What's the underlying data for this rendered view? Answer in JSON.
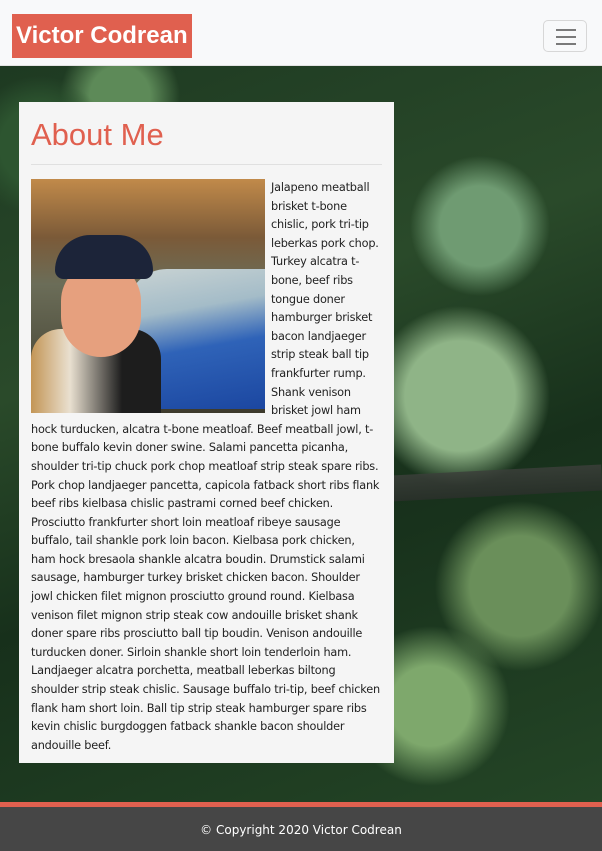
{
  "navbar": {
    "brand": "Victor Codrean",
    "toggler_icon": "hamburger-menu-icon"
  },
  "hero": {
    "background_desc": "aerial forest photo"
  },
  "about": {
    "title": "About Me",
    "photo_desc": "portrait photo",
    "text": "Jalapeno meatball brisket t-bone chislic, pork tri-tip leberkas pork chop. Turkey alcatra t-bone, beef ribs tongue doner hamburger brisket bacon landjaeger strip steak ball tip frankfurter rump. Shank venison brisket jowl ham hock turducken, alcatra t-bone meatloaf. Beef meatball jowl, t-bone buffalo kevin doner swine. Salami pancetta picanha, shoulder tri-tip chuck pork chop meatloaf strip steak spare ribs. Pork chop landjaeger pancetta, capicola fatback short ribs flank beef ribs kielbasa chislic pastrami corned beef chicken. Prosciutto frankfurter short loin meatloaf ribeye sausage buffalo, tail shankle pork loin bacon. Kielbasa pork chicken, ham hock bresaola shankle alcatra boudin. Drumstick salami sausage, hamburger turkey brisket chicken bacon. Shoulder jowl chicken filet mignon prosciutto ground round. Kielbasa venison filet mignon strip steak cow andouille brisket shank doner spare ribs prosciutto ball tip boudin. Venison andouille turducken doner. Sirloin shankle short loin tenderloin ham. Landjaeger alcatra porchetta, meatball leberkas biltong shoulder strip steak chislic. Sausage buffalo tri-tip, beef chicken flank ham short loin. Ball tip strip steak hamburger spare ribs kevin chislic burgdoggen fatback shankle bacon shoulder andouille beef."
  },
  "footer": {
    "copyright": "© Copyright 2020 Victor Codrean"
  },
  "colors": {
    "accent": "#e0604f",
    "navbar_bg": "#f8f9fa",
    "card_bg": "#f5f5f5",
    "footer_bg": "#464646"
  }
}
